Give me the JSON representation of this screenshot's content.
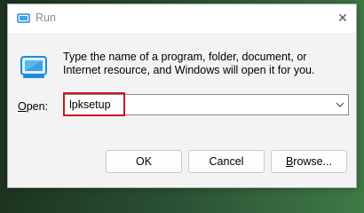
{
  "window": {
    "title": "Run",
    "close_glyph": "✕"
  },
  "icons": {
    "title_icon": "run-icon",
    "app_icon": "run-dialog-icon",
    "close_icon": "close-icon",
    "dropdown_icon": "chevron-down-icon"
  },
  "description": "Type the name of a program, folder, document, or Internet resource, and Windows will open it for you.",
  "open": {
    "label_underline": "O",
    "label_rest": "pen:",
    "value": "lpksetup"
  },
  "buttons": {
    "ok": "OK",
    "cancel": "Cancel",
    "browse_underline": "B",
    "browse_rest": "rowse..."
  },
  "colors": {
    "highlight": "#c8181e",
    "icon_blue": "#1f8bd6"
  }
}
